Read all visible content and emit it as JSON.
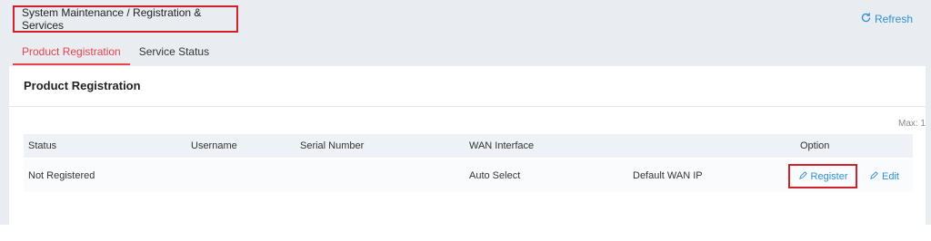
{
  "header": {
    "breadcrumb": "System Maintenance / Registration & Services",
    "refresh_label": "Refresh"
  },
  "tabs": [
    {
      "label": "Product Registration",
      "active": true
    },
    {
      "label": "Service Status",
      "active": false
    }
  ],
  "panel": {
    "title": "Product Registration",
    "max_label": "Max: 1",
    "columns": [
      "Status",
      "Username",
      "Serial Number",
      "WAN Interface",
      "",
      "Option"
    ],
    "rows": [
      {
        "status": "Not Registered",
        "username": "",
        "serial_number": "",
        "wan_interface": "Auto Select",
        "wan_ip": "Default WAN IP",
        "actions": {
          "register": "Register",
          "edit": "Edit"
        }
      }
    ]
  },
  "colors": {
    "accent": "#e8424c",
    "link": "#2e8fd6",
    "highlight_box": "#d0202a"
  },
  "icons": [
    "refresh-icon",
    "pencil-icon"
  ]
}
